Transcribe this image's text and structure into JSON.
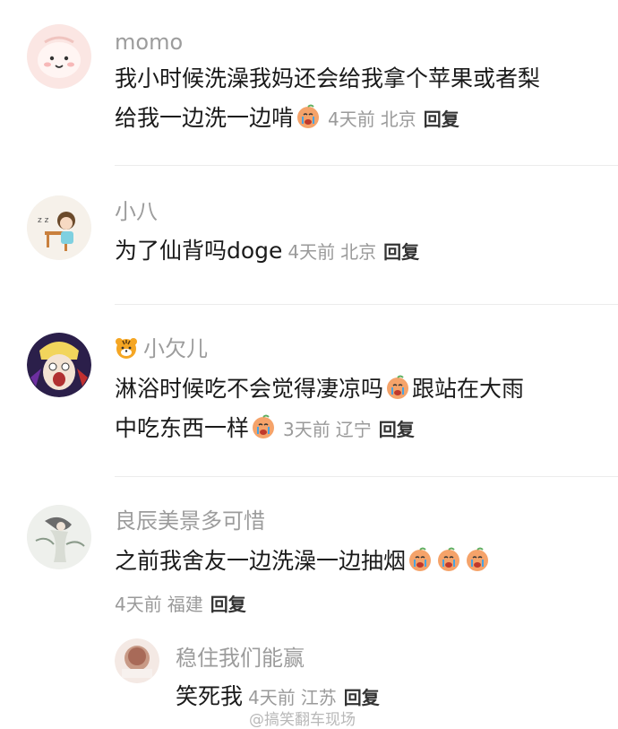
{
  "comments": [
    {
      "username": "momo",
      "line1": "我小时候洗澡我妈还会给我拿个苹果或者梨",
      "line2": "给我一边洗一边啃",
      "time": "4天前",
      "location": "北京",
      "reply": "回复"
    },
    {
      "username": "小八",
      "line1": "为了仙背吗doge",
      "time": "4天前",
      "location": "北京",
      "reply": "回复"
    },
    {
      "username": "小欠儿",
      "line1_a": "淋浴时候吃不会觉得凄凉吗",
      "line1_b": "跟站在大雨",
      "line2": "中吃东西一样",
      "time": "3天前",
      "location": "辽宁",
      "reply": "回复"
    },
    {
      "username": "良辰美景多可惜",
      "line1": "之前我舍友一边洗澡一边抽烟",
      "time": "4天前",
      "location": "福建",
      "reply": "回复",
      "sub_reply": {
        "username": "稳住我们能赢",
        "text": "笑死我",
        "time": "4天前",
        "location": "江苏",
        "reply": "回复"
      }
    }
  ],
  "watermark": "@搞笑翻车现场",
  "icons": {
    "crying_emoji": "crying-emoji-icon",
    "tiger_emoji": "tiger-icon"
  },
  "colors": {
    "username": "#9c9c9c",
    "meta": "#9a9a9a",
    "text": "#1a1a1a",
    "divider": "#ececec"
  }
}
